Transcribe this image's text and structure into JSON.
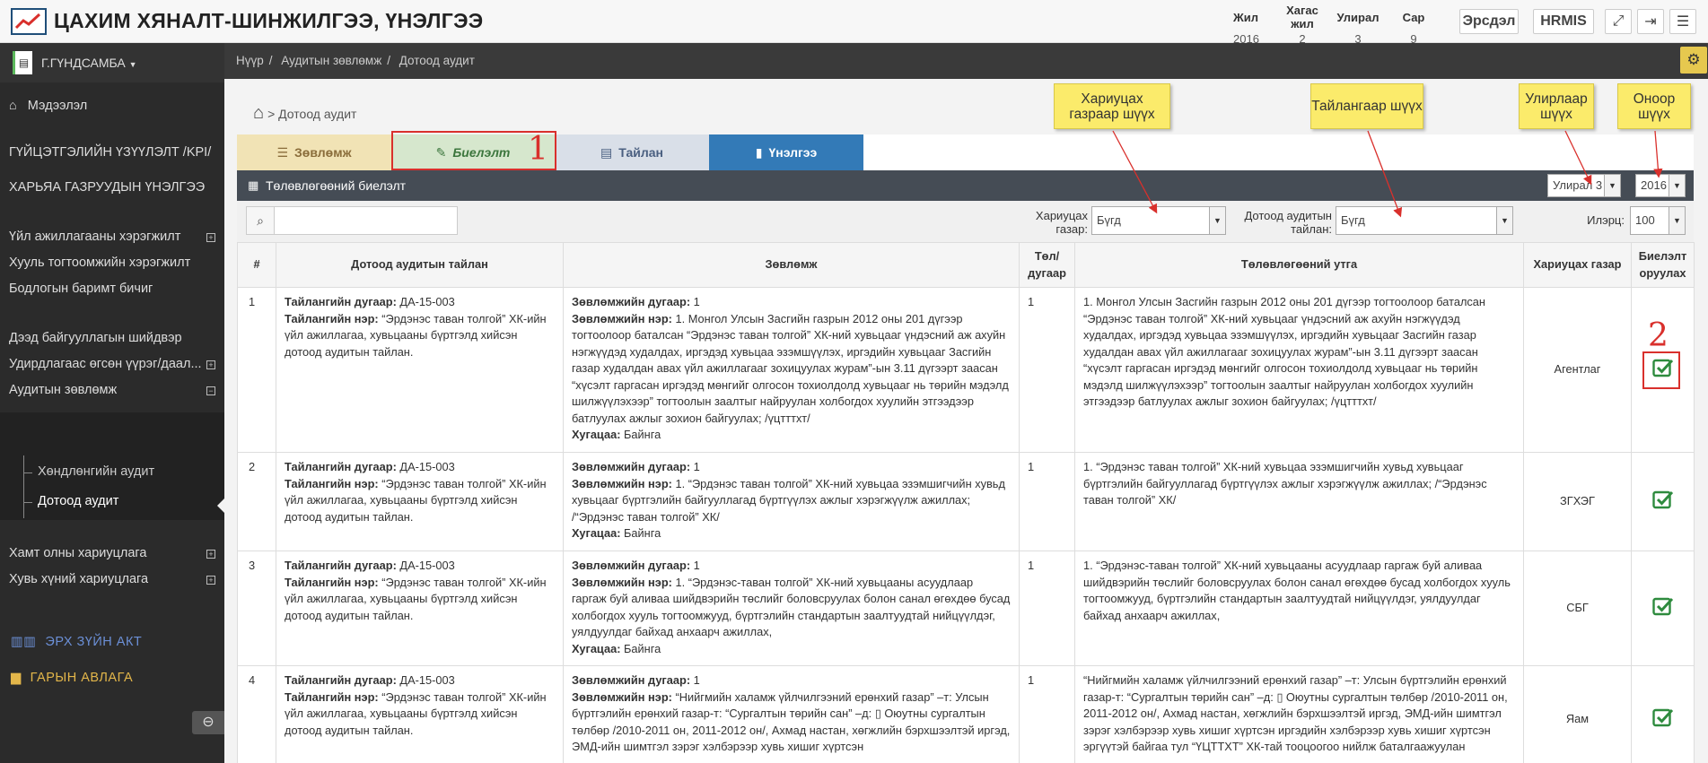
{
  "header": {
    "title": "ЦАХИМ ХЯНАЛТ-ШИНЖИЛГЭЭ, ҮНЭЛГЭЭ",
    "period": {
      "labels": [
        "Жил",
        "Хагас жил",
        "Улирал",
        "Сар"
      ],
      "values": [
        "2016",
        "2",
        "3",
        "9"
      ]
    },
    "buttons": {
      "risk": "Эрсдэл",
      "hrmis": "HRMIS"
    },
    "icons": [
      "expand-icon",
      "logout-icon",
      "menu-icon"
    ]
  },
  "sidebar": {
    "user": "Г.ГҮНДСАМБА",
    "items": [
      {
        "label": "Мэдээлэл"
      },
      {
        "label": "ГҮЙЦЭТГЭЛИЙН ҮЗҮҮЛЭЛТ /KPI/"
      },
      {
        "label": "ХАРЬЯА ГАЗРУУДЫН ҮНЭЛГЭЭ"
      },
      {
        "label": "Үйл ажиллагааны хэрэгжилт"
      },
      {
        "label": "Хууль тогтоомжийн хэрэгжилт"
      },
      {
        "label": "Бодлогын баримт бичиг"
      },
      {
        "label": "Дээд байгууллагын шийдвэр"
      },
      {
        "label": "Удирдлагаас өгсөн үүрэг/даал..."
      },
      {
        "label": "Аудитын зөвлөмж"
      },
      {
        "label": "Хөндлөнгийн аудит"
      },
      {
        "label": "Дотоод аудит"
      },
      {
        "label": "Хамт олны хариуцлага"
      },
      {
        "label": "Хувь хүний хариуцлага"
      },
      {
        "label": "ЭРХ ЗҮЙН АКТ"
      },
      {
        "label": "ГАРЫН АВЛАГА"
      }
    ]
  },
  "breadcrumb": [
    "Нүүр",
    "Аудитын зөвлөмж",
    "Дотоод аудит"
  ],
  "page": {
    "heading": "> Дотоод аудит",
    "tabs": [
      "Зөвлөмж",
      "Биелэлт",
      "Тайлан",
      "Үнэлгээ"
    ],
    "panel_title": "Төлөвлөгөөний биелэлт",
    "quarter_value": "Улирал 3",
    "year_value": "2016"
  },
  "filters": {
    "org_label": "Хариуцах газар:",
    "org_value": "Бүгд",
    "report_label": "Дотоод аудитын тайлан:",
    "report_value": "Бүгд",
    "count_label": "Илэрц:",
    "count_value": "100"
  },
  "annotations": {
    "num1": "1",
    "num2": "2",
    "c_org": "Хариуцах газраар шүүх",
    "c_report": "Тайлангаар шүүх",
    "c_quarter": "Улирлаар шүүх",
    "c_year": "Оноор шүүх"
  },
  "table": {
    "columns": [
      "#",
      "Дотоод аудитын тайлан",
      "Зөвлөмж",
      "Төл/ дугаар",
      "Төлөвлөгөөний утга",
      "Хариуцах газар",
      "Биелэлт оруулах"
    ],
    "labels": {
      "report_no": "Тайлангийн дугаар:",
      "report_name": "Тайлангийн нэр:",
      "rec_no": "Зөвлөмжийн дугаар:",
      "rec_name": "Зөвлөмжийн нэр:",
      "deadline": "Хугацаа:"
    },
    "rows": [
      {
        "n": "1",
        "report_no": "ДА-15-003",
        "report_name": "“Эрдэнэс таван толгой” ХК-ийн үйл ажиллагаа, хувьцааны бүртгэлд хийсэн дотоод аудитын тайлан.",
        "rec_no": "1",
        "rec_name": "1. Монгол Улсын Засгийн газрын 2012 оны 201 дүгээр тогтоолоор баталсан “Эрдэнэс таван толгой” ХК-ний хувьцааг үндэсний аж ахуйн нэгжүүдэд худалдах, иргэдэд хувьцаа эзэмшүүлэх, иргэдийн хувьцааг Засгийн газар худалдан авах үйл ажиллагааг зохицуулах журам”-ын 3.11 дүгээрт заасан “хүсэлт гаргасан иргэдэд мөнгийг олгосон тохиолдолд хувьцааг нь төрийн мэдэлд шилжүүлэхээр” тогтоолын заалтыг найруулан холбогдох хуулийн этгээдээр батлуулах ажлыг зохион байгуулах; /үцтттхт/",
        "deadline": "Байнга",
        "tol": "1",
        "plan": "1. Монгол Улсын Засгийн газрын 2012 оны 201 дүгээр тогтоолоор баталсан “Эрдэнэс таван толгой” ХК-ний хувьцааг үндэсний аж ахуйн нэгжүүдэд худалдах, иргэдэд хувьцаа эзэмшүүлэх, иргэдийн хувьцааг Засгийн газар худалдан авах үйл ажиллагааг зохицуулах журам”-ын 3.11 дүгээрт заасан “хүсэлт гаргасан иргэдэд мөнгийг олгосон тохиолдолд хувьцааг нь төрийн мэдэлд шилжүүлэхээр” тогтоолын заалтыг найруулан холбогдох хуулийн этгээдээр батлуулах ажлыг зохион байгуулах; /үцтттхт/",
        "org": "Агентлаг"
      },
      {
        "n": "2",
        "report_no": "ДА-15-003",
        "report_name": "“Эрдэнэс таван толгой” ХК-ийн үйл ажиллагаа, хувьцааны бүртгэлд хийсэн дотоод аудитын тайлан.",
        "rec_no": "1",
        "rec_name": "1. “Эрдэнэс таван толгой” ХК-ний хувьцаа эзэмшигчийн хувьд хувьцааг бүртгэлийн байгууллагад бүртгүүлэх ажлыг хэрэгжүүлж ажиллах; /“Эрдэнэс таван толгой” ХК/",
        "deadline": "Байнга",
        "tol": "1",
        "plan": "1. “Эрдэнэс таван толгой” ХК-ний хувьцаа эзэмшигчийн хувьд хувьцааг бүртгэлийн байгууллагад бүртгүүлэх ажлыг хэрэгжүүлж ажиллах; /“Эрдэнэс таван толгой” ХК/",
        "org": "ЗГХЭГ"
      },
      {
        "n": "3",
        "report_no": "ДА-15-003",
        "report_name": "“Эрдэнэс таван толгой” ХК-ийн үйл ажиллагаа, хувьцааны бүртгэлд хийсэн дотоод аудитын тайлан.",
        "rec_no": "1",
        "rec_name": "1. “Эрдэнэс-таван толгой” ХК-ний хувьцааны асуудлаар гаргаж буй аливаа шийдвэрийн төслийг боловсруулах болон санал өгөхдөө бусад холбогдох хууль тогтоомжууд, бүртгэлийн стандартын заалтуудтай нийцүүлдэг, уялдуулдаг байхад анхаарч ажиллах,",
        "deadline": "Байнга",
        "tol": "1",
        "plan": "1. “Эрдэнэс-таван толгой” ХК-ний хувьцааны асуудлаар гаргаж буй аливаа шийдвэрийн төслийг боловсруулах болон санал өгөхдөө бусад холбогдох хууль тогтоомжууд, бүртгэлийн стандартын заалтуудтай нийцүүлдэг, уялдуулдаг байхад анхаарч ажиллах,",
        "org": "СБГ"
      },
      {
        "n": "4",
        "report_no": "ДА-15-003",
        "report_name": "“Эрдэнэс таван толгой” ХК-ийн үйл ажиллагаа, хувьцааны бүртгэлд хийсэн дотоод аудитын тайлан.",
        "rec_no": "1",
        "rec_name": "“Нийгмийн халамж үйлчилгээний ерөнхий газар” –т: Улсын бүртгэлийн ерөнхий газар-т: “Сургалтын төрийн сан” –д: ▯ Оюутны сургалтын төлбөр /2010-2011 он, 2011-2012 он/, Ахмад настан, хөгжлийн бэрхшээлтэй иргэд, ЭМД-ийн шимтгэл зэрэг хэлбэрээр хувь хишиг хүртсэн",
        "deadline": "",
        "tol": "1",
        "plan": "“Нийгмийн халамж үйлчилгээний ерөнхий газар” –т: Улсын бүртгэлийн ерөнхий газар-т: “Сургалтын төрийн сан” –д: ▯ Оюутны сургалтын төлбөр /2010-2011 он, 2011-2012 он/, Ахмад настан, хөгжлийн бэрхшээлтэй иргэд, ЭМД-ийн шимтгэл зэрэг хэлбэрээр хувь хишиг хүртсэн иргэдийн хэлбэрээр хувь хишиг хүртсэн эргүүтэй байгаа тул “ҮЦТТХТ” ХК-тай тооцоогоо нийлж баталгаажуулан",
        "org": "Яам"
      }
    ]
  },
  "colors": {
    "accent": "#337ab7",
    "annotation": "#d9302c",
    "callout": "#fbeb6b",
    "check": "#2e8b3e"
  }
}
